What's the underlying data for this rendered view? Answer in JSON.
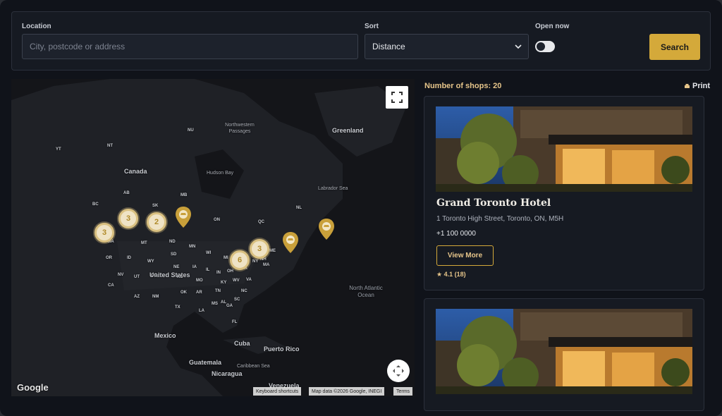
{
  "search": {
    "location_label": "Location",
    "location_placeholder": "City, postcode or address",
    "sort_label": "Sort",
    "sort_value": "Distance",
    "open_now_label": "Open now",
    "search_button": "Search"
  },
  "map": {
    "regions": [
      "Greenland",
      "Canada",
      "United States",
      "Mexico",
      "Cuba",
      "Puerto Rico",
      "Guatemala",
      "Nicaragua",
      "Venezuela"
    ],
    "places": [
      "Northwestern Passages",
      "Hudson Bay",
      "Labrador Sea",
      "Caribbean Sea"
    ],
    "ocean": "North Atlantic Ocean",
    "states": [
      "NU",
      "YT",
      "NT",
      "AB",
      "MB",
      "BC",
      "SK",
      "ON",
      "QC",
      "NL",
      "WA",
      "MT",
      "ND",
      "MN",
      "OR",
      "ID",
      "WY",
      "SD",
      "WI",
      "MI",
      "NY",
      "NE",
      "IA",
      "IL",
      "IN",
      "OH",
      "PA",
      "CA",
      "NV",
      "UT",
      "CO",
      "KS",
      "MO",
      "KY",
      "WV",
      "VA",
      "AZ",
      "NM",
      "OK",
      "AR",
      "TN",
      "NC",
      "TX",
      "LA",
      "MS",
      "AL",
      "GA",
      "SC",
      "FL",
      "ME",
      "NH",
      "MA"
    ],
    "clusters": [
      "3",
      "3",
      "2",
      "6",
      "3"
    ],
    "google": "Google",
    "attribution": [
      "Keyboard shortcuts",
      "Map data ©2026 Google, INEGI",
      "Terms"
    ]
  },
  "results": {
    "count_text": "Number of shops: 20",
    "print_label": "Print",
    "cards": [
      {
        "name": "Grand Toronto Hotel",
        "address": "1 Toronto High Street, Toronto, ON, M5H",
        "phone": "+1 100 0000",
        "button": "View More",
        "rating": "4.1 (18)"
      },
      {
        "name": "",
        "address": "",
        "phone": "",
        "button": "",
        "rating": ""
      }
    ]
  },
  "colors": {
    "accent": "#d4a93a",
    "background": "#10131a",
    "panel": "#161a22"
  }
}
